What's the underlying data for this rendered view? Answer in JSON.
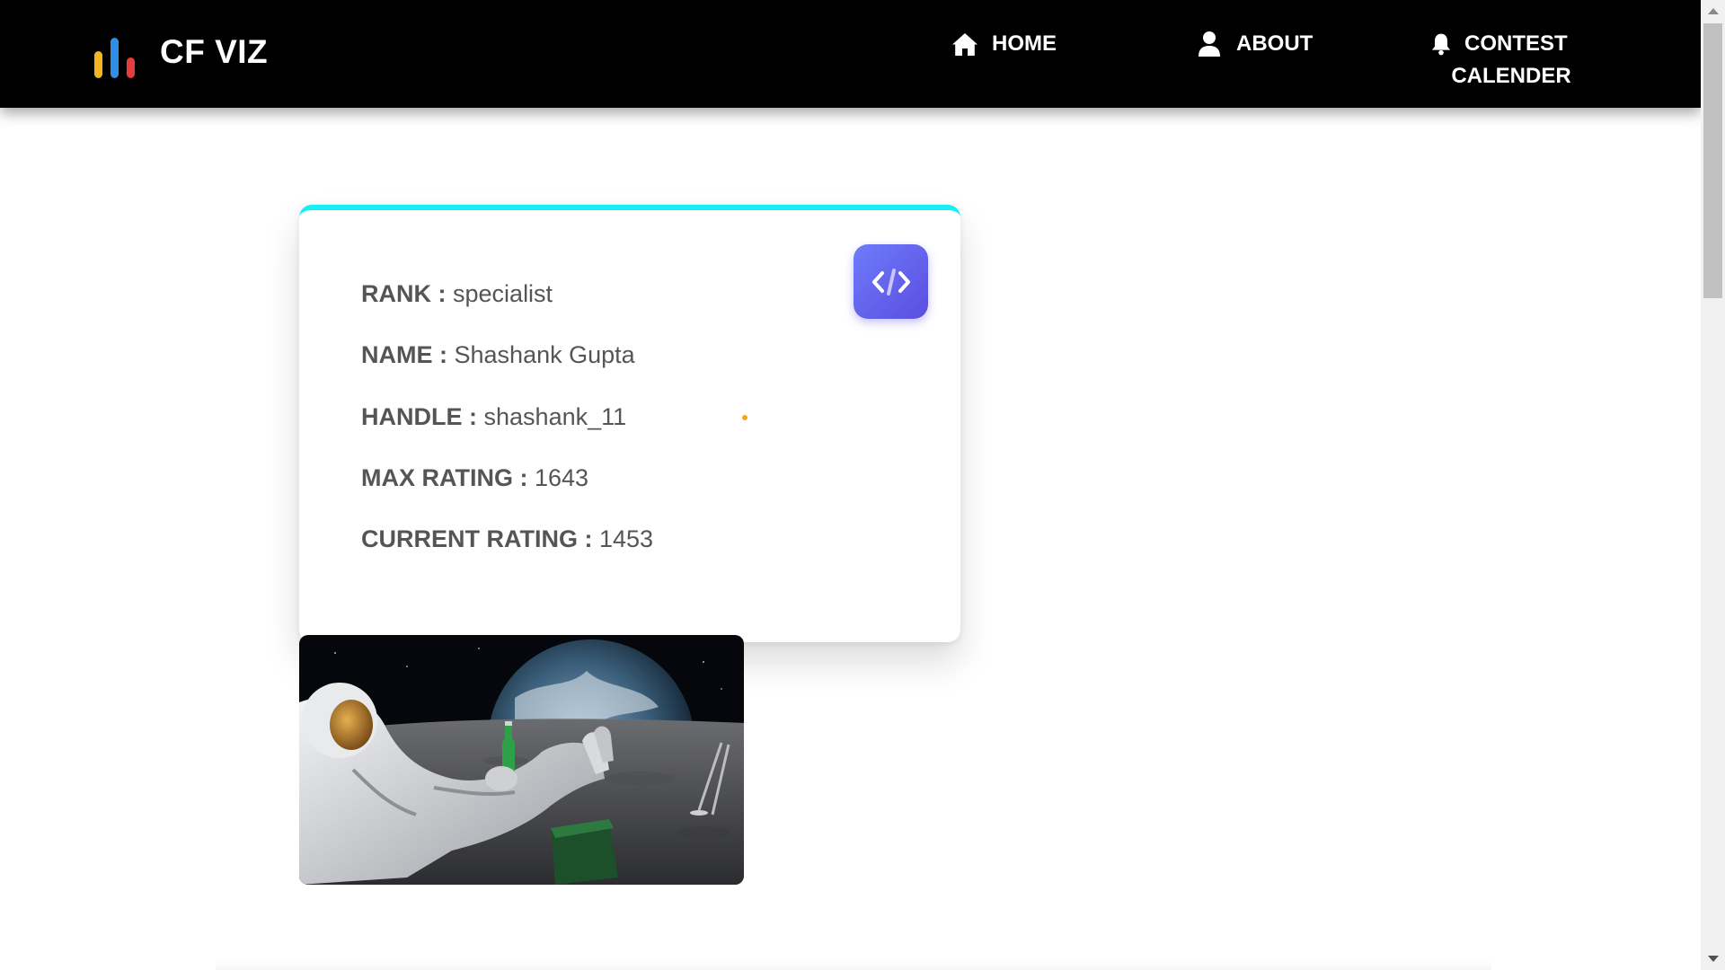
{
  "brand": {
    "name": "CF VIZ",
    "logo_icon": "bar-chart-logo-icon",
    "logo_colors": [
      "#f3b51b",
      "#2f8ee6",
      "#e53c3c"
    ]
  },
  "nav": {
    "items": [
      {
        "label": "HOME",
        "icon": "home-icon"
      },
      {
        "label": "ABOUT",
        "icon": "user-icon"
      },
      {
        "label_line1": "CONTEST",
        "label_line2": "CALENDER",
        "icon": "bell-icon"
      }
    ]
  },
  "profile": {
    "accent_color": "#16f0f4",
    "badge_icon": "code-icon",
    "fields": {
      "rank": {
        "label": "RANK :",
        "value": "specialist"
      },
      "name": {
        "label": "NAME :",
        "value": "Shashank Gupta"
      },
      "handle": {
        "label": "HANDLE :",
        "value": "shashank_11"
      },
      "max_rating": {
        "label": "MAX RATING :",
        "value": "1643"
      },
      "current_rating": {
        "label": "CURRENT RATING :",
        "value": "1453"
      }
    }
  },
  "image": {
    "subject": "astronaut-on-moon-image"
  }
}
